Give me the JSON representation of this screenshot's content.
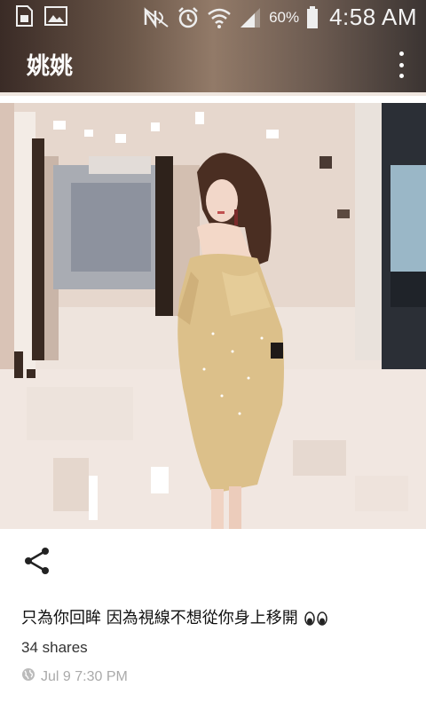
{
  "status_bar": {
    "battery_percent": "60%",
    "time": "4:58 AM",
    "icons": [
      "sim-card-icon",
      "image-notification-icon",
      "nfc-icon",
      "alarm-icon",
      "wifi-icon",
      "signal-icon",
      "battery-icon"
    ]
  },
  "app_bar": {
    "title": "姚姚",
    "overflow_icon": "more-vertical-icon"
  },
  "post": {
    "share_icon": "share-icon",
    "caption": "只為你回眸 因為視線不想從你身上移開",
    "caption_emoji": "👀",
    "shares": "34 shares",
    "visibility_icon": "globe-icon",
    "timestamp": "Jul 9 7:30 PM"
  },
  "colors": {
    "app_bar_text": "#ffffff",
    "caption_text": "#111111",
    "meta_text": "#aaaaaa"
  }
}
